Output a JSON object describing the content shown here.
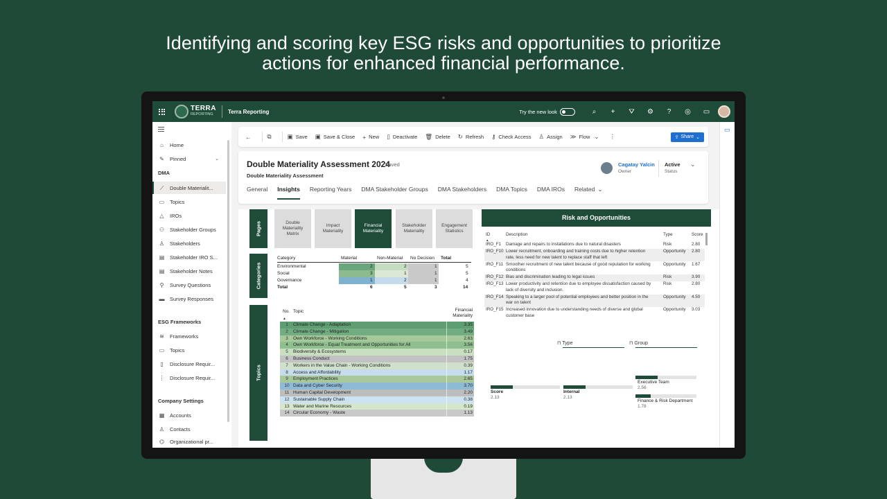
{
  "headline": {
    "line1": "Identifying and scoring key ESG risks and opportunities to prioritize",
    "line2": "actions for enhanced financial performance."
  },
  "topbar": {
    "logo_title": "TERRA",
    "logo_sub": "REPORTING",
    "app_name": "Terra Reporting",
    "try_new_look": "Try the new look"
  },
  "nav": {
    "home": "Home",
    "pinned": "Pinned",
    "dma_header": "DMA",
    "dma_items": [
      "Double Materialit...",
      "Topics",
      "IROs",
      "Stakeholder Groups",
      "Stakeholders",
      "Stakeholder IRO S...",
      "Stakeholder Notes",
      "Survey Questions",
      "Survey Responses"
    ],
    "esg_header": "ESG Frameworks",
    "esg_items": [
      "Frameworks",
      "Topics",
      "Disclosure Requir...",
      "Disclosure Requir..."
    ],
    "company_header": "Company Settings",
    "company_items": [
      "Accounts",
      "Contacts",
      "Organizational pr..."
    ]
  },
  "commands": {
    "save": "Save",
    "save_close": "Save & Close",
    "new": "New",
    "deactivate": "Deactivate",
    "delete": "Delete",
    "refresh": "Refresh",
    "check_access": "Check Access",
    "assign": "Assign",
    "flow": "Flow",
    "share": "Share"
  },
  "record": {
    "title": "Double Materiality Assessment 2024",
    "saved": "- Saved",
    "entity": "Double Materiality Assessment",
    "owner_name": "Cagatay Yalcin",
    "owner_label": "Owner",
    "status_value": "Active",
    "status_label": "Status"
  },
  "tabs": [
    "General",
    "Insights",
    "Reporting Years",
    "DMA Stakeholder Groups",
    "DMA Stakeholders",
    "DMA Topics",
    "DMA IROs",
    "Related"
  ],
  "report": {
    "section_pages": "Pages",
    "section_categories": "Categories",
    "section_topics": "Topics",
    "page_buttons": [
      "Double Materiality Matrix",
      "Impact Materiality",
      "Financial Materiality",
      "Stakeholder Materiality",
      "Engagement Statistics"
    ],
    "categories": {
      "headers": [
        "Category",
        "Material",
        "Non-Material",
        "No Decision",
        "Total"
      ],
      "rows": [
        {
          "name": "Environmental",
          "material": "2",
          "non_material": "2",
          "no_decision": "1",
          "total": "5"
        },
        {
          "name": "Social",
          "material": "3",
          "non_material": "1",
          "no_decision": "1",
          "total": "5"
        },
        {
          "name": "Governance",
          "material": "1",
          "non_material": "2",
          "no_decision": "1",
          "total": "4"
        },
        {
          "name": "Total",
          "material": "6",
          "non_material": "5",
          "no_decision": "3",
          "total": "14"
        }
      ]
    },
    "topics": {
      "headers": {
        "no": "No.",
        "topic": "Topic",
        "financial_line1": "Financial",
        "financial_line2": "Materiality"
      },
      "rows": [
        {
          "no": "1",
          "topic": "Climate Change - Adaptation",
          "value": "3.35",
          "color": "#5f9e72"
        },
        {
          "no": "2",
          "topic": "Climate Change - Mitigation",
          "value": "3.49",
          "color": "#72ad82"
        },
        {
          "no": "3",
          "topic": "Own Workforce - Working Conditions",
          "value": "2.63",
          "color": "#a6c99c"
        },
        {
          "no": "4",
          "topic": "Own Workforce - Equal Treatment and Opportunities for All",
          "value": "3.56",
          "color": "#8fbf8f"
        },
        {
          "no": "5",
          "topic": "Biodiversity & Ecosystems",
          "value": "0.17",
          "color": "#c8dfc0"
        },
        {
          "no": "6",
          "topic": "Business Conduct",
          "value": "1.75",
          "color": "#c2c2c2"
        },
        {
          "no": "7",
          "topic": "Workers in the Value Chain - Working Conditions",
          "value": "0.39",
          "color": "#cfe1ca"
        },
        {
          "no": "8",
          "topic": "Access and Affordability",
          "value": "1.17",
          "color": "#c5dced"
        },
        {
          "no": "9",
          "topic": "Employment Practices",
          "value": "2.65",
          "color": "#a9c89a"
        },
        {
          "no": "10",
          "topic": "Data and Cyber Security",
          "value": "3.70",
          "color": "#8fbad6"
        },
        {
          "no": "11",
          "topic": "Human Capital Development",
          "value": "2.20",
          "color": "#bdbdbd"
        },
        {
          "no": "12",
          "topic": "Sustainable Supply Chain",
          "value": "0.38",
          "color": "#cde2f0"
        },
        {
          "no": "13",
          "topic": "Water and Marine Resources",
          "value": "0.19",
          "color": "#d4e6cc"
        },
        {
          "no": "14",
          "topic": "Circular Economy - Waste",
          "value": "1.13",
          "color": "#c9c9c9"
        }
      ]
    },
    "risk": {
      "title": "Risk and Opportunities",
      "headers": {
        "id": "ID",
        "description": "Description",
        "type": "Type",
        "score": "Score"
      },
      "rows": [
        {
          "id": "IRO_F1",
          "line1": "Damage and repairs to installations due to natural disasters",
          "line2": "",
          "type": "Risk",
          "score": "2.80"
        },
        {
          "id": "IRO_F10",
          "line1": "Lower recruitment, onboarding and training costs due to higher retention",
          "line2": "rate, less need for new talent to replace staff that left",
          "type": "Opportunity",
          "score": "2.80"
        },
        {
          "id": "IRO_F11",
          "line1": "Smoother recruitment of new talent because of good reputation for working",
          "line2": "conditions",
          "type": "Opportunity",
          "score": "1.67"
        },
        {
          "id": "IRO_F12",
          "line1": "Bias and discrimination leading to legal issues",
          "line2": "",
          "type": "Risk",
          "score": "3.90"
        },
        {
          "id": "IRO_F13",
          "line1": "Lower productivity and retention due to employee dissatisfaction caused by",
          "line2": "lack of diversity and inclusion.",
          "type": "Risk",
          "score": "2.80"
        },
        {
          "id": "IRO_F14",
          "line1": "Speaking to a larger pool of potential employees and better position in the",
          "line2": "war on talent",
          "type": "Opportunity",
          "score": "4.50"
        },
        {
          "id": "IRO_F15",
          "line1": "Increased innovation due to understanding needs of diverse and global",
          "line2": "customer base",
          "type": "Opportunity",
          "score": "3.03"
        }
      ]
    },
    "filters": {
      "type": "Type",
      "group": "Group"
    },
    "score_bars": [
      {
        "label": "Score",
        "value": "2.13"
      },
      {
        "label": "Internal",
        "value": "2.13"
      }
    ],
    "group_bars": [
      {
        "label": "Executive Team",
        "value": "2.56"
      },
      {
        "label": "Finance & Risk Department",
        "value": "1.78"
      }
    ]
  },
  "colors": {
    "brand_green": "#1e4c38",
    "background": "#1f4a37",
    "link_blue": "#1e6fd0"
  }
}
